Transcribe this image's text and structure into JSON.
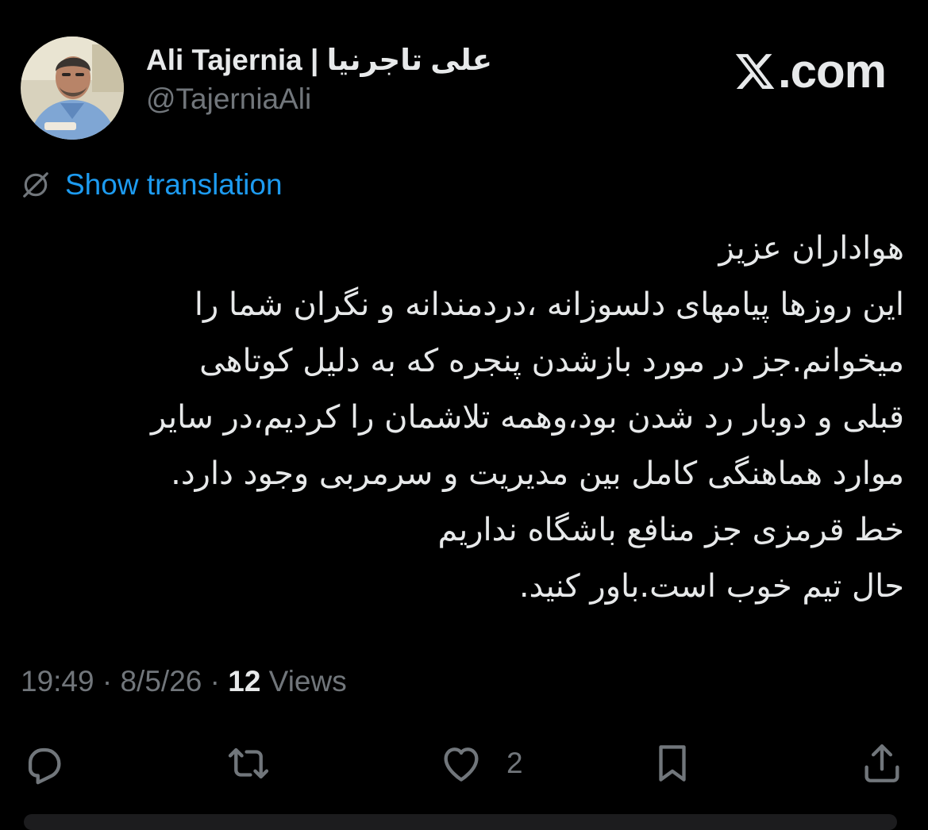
{
  "author": {
    "display_name": "Ali Tajernia | علی تاجرنیا",
    "handle": "@TajerniaAli",
    "avatar": "avatar-photo"
  },
  "brand": {
    "icon": "x-logo-icon",
    "label": ".com"
  },
  "translate": {
    "icon": "globe-slash-icon",
    "label": "Show translation"
  },
  "tweet": {
    "lines": [
      "هواداران عزیز",
      "این روزها پیامهای دلسوزانه ،دردمندانه و نگران شما را",
      "میخوانم.جز در مورد بازشدن پنجره که به دلیل کوتاهی",
      "قبلی و دوبار رد شدن بود،وهمه تلاشمان را کردیم،در سایر",
      "موارد هماهنگی کامل بین مدیریت و سرمربی وجود دارد.",
      "خط قرمزی جز منافع باشگاه نداریم",
      "حال تیم خوب است.باور کنید."
    ]
  },
  "meta": {
    "time": "19:49",
    "separator": " · ",
    "date": "8/5/26",
    "views_count": "12",
    "views_label": " Views"
  },
  "actions": {
    "reply": {
      "icon": "reply-icon"
    },
    "retweet": {
      "icon": "retweet-icon"
    },
    "like": {
      "icon": "heart-icon",
      "count": "2"
    },
    "bookmark": {
      "icon": "bookmark-icon"
    },
    "share": {
      "icon": "share-icon"
    }
  },
  "colors": {
    "background": "#000000",
    "text": "#e7e9ea",
    "muted": "#71767b",
    "link": "#1d9bf0"
  }
}
